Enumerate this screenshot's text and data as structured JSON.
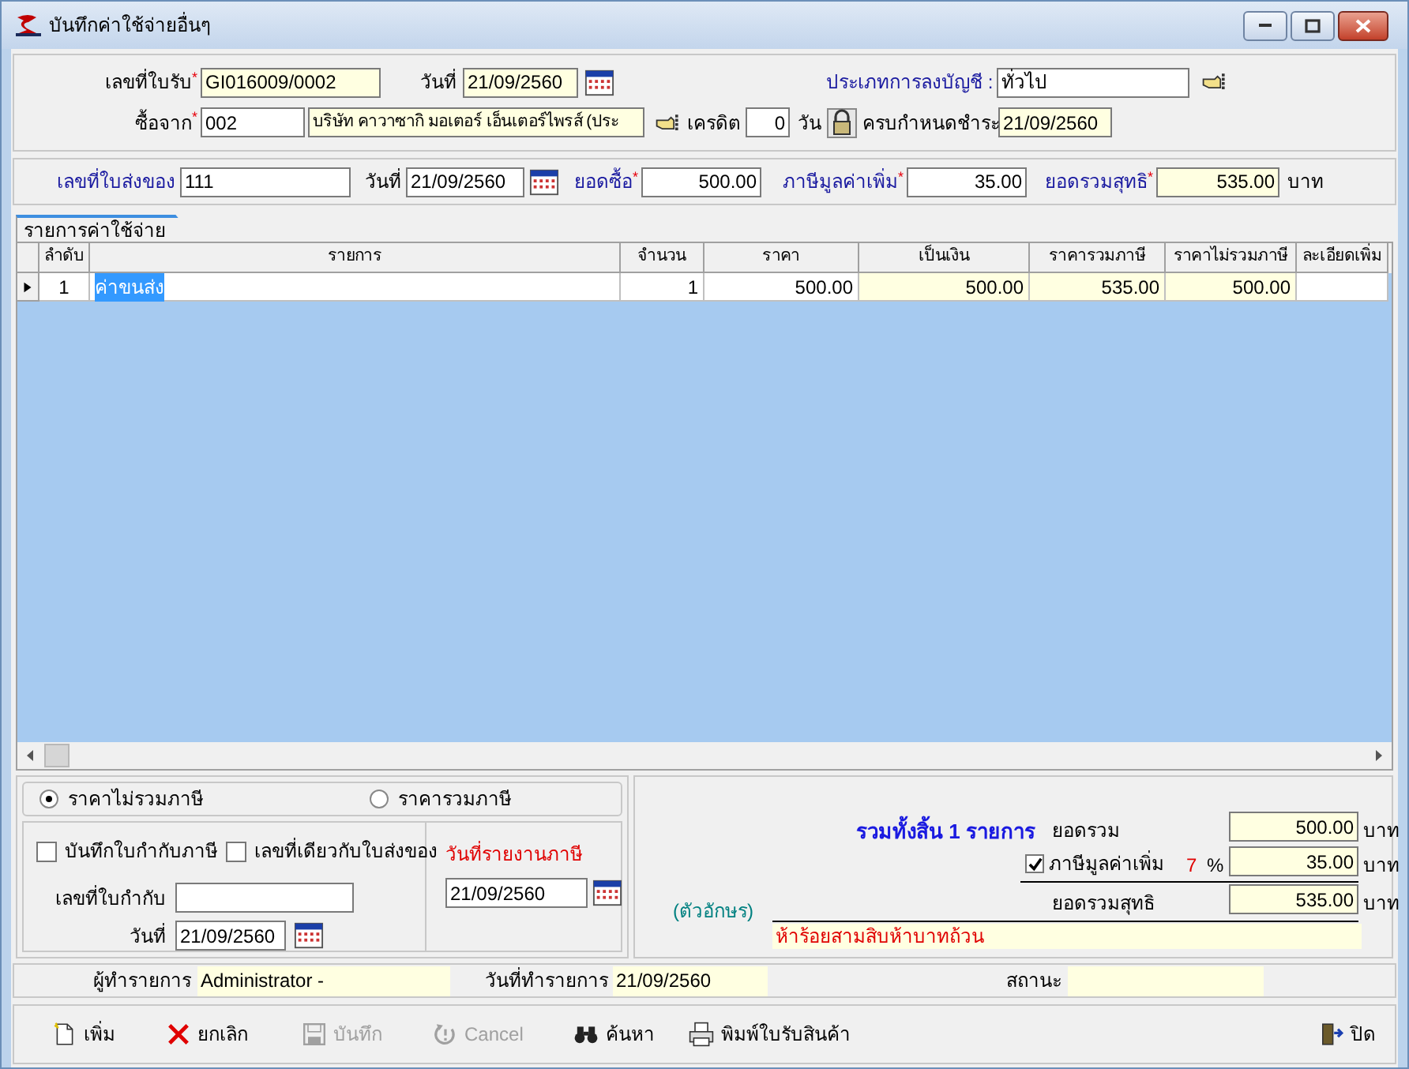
{
  "window": {
    "title": "บันทึกค่าใช้จ่ายอื่นๆ"
  },
  "header_rows": [
    [
      {
        "kind": "label",
        "text": "เลขที่ใบรับ$^{*}$"
      },
      {
        "kind": "input",
        "value": "GI016009/0002",
        "readonly": true
      },
      {
        "kind": "label",
        "text": "วันที่"
      },
      {
        "kind": "input",
        "value": "21/09/2560",
        "readonly": true
      },
      {
        "kind": "calendar"
      },
      {
        "kind": "label_accent",
        "text": "ประเภทการลงบัญชี :"
      },
      {
        "kind": "input",
        "value": "ทั่วไป",
        "readonly": false
      },
      {
        "kind": "lookup"
      }
    ],
    [
      {
        "kind": "label",
        "text": "ซื้อจาก$^{*}$"
      },
      {
        "kind": "input",
        "value": "002",
        "readonly": false
      },
      {
        "kind": "input",
        "value": "บริษัท คาวาซากิ มอเตอร์ เอ็นเตอร์ไพรส์ (ประ",
        "readonly": true
      },
      {
        "kind": "lookup"
      },
      {
        "kind": "label",
        "text": "เครดิต"
      },
      {
        "kind": "input",
        "value": "0",
        "readonly": false,
        "numeric": true
      },
      {
        "kind": "label",
        "text": "วัน"
      },
      {
        "kind": "lock"
      },
      {
        "kind": "label",
        "text": "ครบกำหนดชำระ"
      },
      {
        "kind": "input",
        "value": "21/09/2560",
        "readonly": true
      }
    ],
    [
      {
        "kind": "label_accent",
        "text": "เลขที่ใบส่งของ"
      },
      {
        "kind": "input",
        "value": "111",
        "readonly": false
      },
      {
        "kind": "label",
        "text": "วันที่"
      },
      {
        "kind": "input",
        "value": "21/09/2560",
        "readonly": false
      },
      {
        "kind": "calendar"
      },
      {
        "kind": "label_accent",
        "text": "ยอดซื้อ$^{*}$"
      },
      {
        "kind": "input",
        "value": "500.00",
        "readonly": false,
        "numeric": true
      },
      {
        "kind": "label_accent",
        "text": "ภาษีมูลค่าเพิ่ม$^{*}$"
      },
      {
        "kind": "input",
        "value": "35.00",
        "readonly": false,
        "numeric": true
      },
      {
        "kind": "label_accent",
        "text": "ยอดรวมสุทธิ$^{*}$"
      },
      {
        "kind": "input",
        "value": "535.00",
        "readonly": true,
        "numeric": true
      },
      {
        "kind": "label",
        "text": "บาท"
      }
    ]
  ],
  "tab": {
    "label": "รายการค่าใช้จ่าย"
  },
  "table": {
    "columns": [
      "ลำดับ",
      "รายการ",
      "จำนวน",
      "ราคา",
      "เป็นเงิน",
      "ราคารวมภาษี",
      "ราคาไม่รวมภาษี",
      "ละเอียดเพิ่ม"
    ],
    "rows": [
      {
        "selected": true,
        "cells": [
          "1",
          "ค่าขนส่ง",
          "1",
          "500.00",
          "500.00",
          "535.00",
          "500.00",
          ""
        ]
      }
    ]
  },
  "price_mode": [
    {
      "label": "ราคาไม่รวมภาษี",
      "selected": true
    },
    {
      "label": "ราคารวมภาษี",
      "selected": false
    }
  ],
  "tax_invoice": {
    "options": [
      {
        "label": "บันทึกใบกำกับภาษี",
        "checked": false
      },
      {
        "label": "เลขที่เดียวกับใบส่งของ",
        "checked": false
      }
    ],
    "number_label": "เลขที่ใบกำกับ",
    "date_label": "วันที่",
    "date": "21/09/2560",
    "report_label": "วันที่รายงานภาษี",
    "report_date": "21/09/2560"
  },
  "summary": {
    "count_text": "รวมทั้งสิ้น 1 รายการ",
    "subtotal_label": "ยอดรวม",
    "subtotal": "500.00",
    "vat_checked": true,
    "vat_label": "ภาษีมูลค่าเพิ่ม",
    "vat_rate": "7",
    "percent": "%",
    "vat": "35.00",
    "net_label": "ยอดรวมสุทธิ",
    "net": "535.00",
    "subtotal_unit": "บาท",
    "vat_unit": "บาท",
    "net_unit": "บาท",
    "words_label": "(ตัวอักษร)",
    "words": "ห้าร้อยสามสิบห้าบาทถ้วน"
  },
  "status": {
    "user_label": "ผู้ทำรายการ",
    "user": "Administrator -",
    "date_label": "วันที่ทำรายการ",
    "date": "21/09/2560",
    "state_label": "สถานะ"
  },
  "toolbar": [
    {
      "kind": "new",
      "label": "เพิ่ม",
      "disabled": false
    },
    {
      "kind": "delete",
      "label": "ยกเลิก",
      "disabled": false
    },
    {
      "kind": "save",
      "label": "บันทึก",
      "disabled": true
    },
    {
      "kind": "undo",
      "label": "Cancel",
      "disabled": true
    },
    {
      "kind": "search",
      "label": "ค้นหา",
      "disabled": false
    },
    {
      "kind": "print",
      "label": "พิมพ์ใบรับสินค้า",
      "disabled": false
    },
    {
      "kind": "exit",
      "label": "ปิด",
      "disabled": false
    }
  ]
}
